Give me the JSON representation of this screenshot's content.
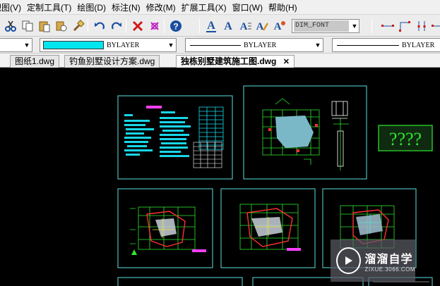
{
  "menu": {
    "items": [
      {
        "label": "视图(V)"
      },
      {
        "label": "定制工具(T)"
      },
      {
        "label": "绘图(D)"
      },
      {
        "label": "标注(N)"
      },
      {
        "label": "修改(M)"
      },
      {
        "label": "扩展工具(X)"
      },
      {
        "label": "窗口(W)"
      },
      {
        "label": "帮助(H)"
      }
    ]
  },
  "toolbar": {
    "text_style_value": "DIM_FONT",
    "text_buttons": [
      "A",
      "A",
      "A",
      "A",
      "A"
    ]
  },
  "properties": {
    "color_label": "BYLAYER",
    "linetype_label": "BYLAYER",
    "lineweight_label": "BYLAYER",
    "color_hex": "#00e5ee"
  },
  "tabs": [
    {
      "label": "图纸1.dwg",
      "active": false
    },
    {
      "label": "钓鱼别墅设计方案.dwg",
      "active": false
    },
    {
      "label": "独栋别墅建筑施工图.dwg",
      "active": true,
      "close": "✕"
    }
  ],
  "drawing": {
    "question_marks": "????",
    "accent_cyan": "#5de0e0",
    "accent_green": "#2ee82e",
    "accent_red": "#ff3030"
  },
  "watermark": {
    "title": "溜溜自学",
    "subtitle": "ZIXUE.3066.COM"
  }
}
